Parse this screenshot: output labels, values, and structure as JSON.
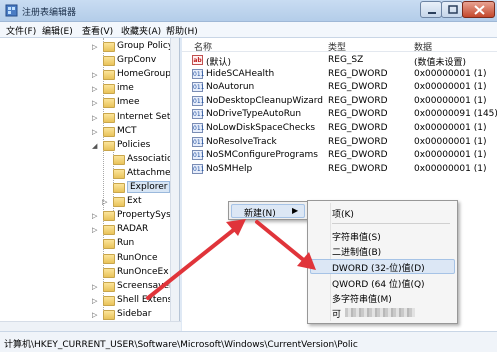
{
  "window": {
    "title": "注册表编辑器"
  },
  "menubar": [
    "文件(F)",
    "编辑(E)",
    "查看(V)",
    "收藏夹(A)",
    "帮助(H)"
  ],
  "tree": {
    "items": [
      {
        "label": "Group Policy",
        "expander": "▷"
      },
      {
        "label": "GrpConv",
        "expander": ""
      },
      {
        "label": "HomeGroup",
        "expander": "▷"
      },
      {
        "label": "ime",
        "expander": "▷"
      },
      {
        "label": "Imee",
        "expander": "▷"
      },
      {
        "label": "Internet Setti",
        "expander": "▷"
      },
      {
        "label": "MCT",
        "expander": "▷"
      },
      {
        "label": "Policies",
        "expander": "◢"
      },
      {
        "label": "Associatic",
        "expander": ""
      },
      {
        "label": "Attachmer",
        "expander": ""
      },
      {
        "label": "Explorer",
        "expander": "",
        "selected": true
      },
      {
        "label": "Ext",
        "expander": "▷"
      },
      {
        "label": "PropertySyste",
        "expander": "▷"
      },
      {
        "label": "RADAR",
        "expander": "▷"
      },
      {
        "label": "Run",
        "expander": ""
      },
      {
        "label": "RunOnce",
        "expander": ""
      },
      {
        "label": "RunOnceEx",
        "expander": ""
      },
      {
        "label": "Screensavers",
        "expander": "▷"
      },
      {
        "label": "Shell Extensic",
        "expander": "▷"
      },
      {
        "label": "Sidebar",
        "expander": "▷"
      }
    ]
  },
  "list": {
    "headers": {
      "name": "名称",
      "type": "类型",
      "data": "数据"
    },
    "rows": [
      {
        "icon": "ab",
        "kind": "sz",
        "name": "(默认)",
        "type": "REG_SZ",
        "data": "(数值未设置)"
      },
      {
        "icon": "011",
        "kind": "dw",
        "name": "HideSCAHealth",
        "type": "REG_DWORD",
        "data": "0x00000001 (1)"
      },
      {
        "icon": "011",
        "kind": "dw",
        "name": "NoAutorun",
        "type": "REG_DWORD",
        "data": "0x00000001 (1)"
      },
      {
        "icon": "011",
        "kind": "dw",
        "name": "NoDesktopCleanupWizard",
        "type": "REG_DWORD",
        "data": "0x00000001 (1)"
      },
      {
        "icon": "011",
        "kind": "dw",
        "name": "NoDriveTypeAutoRun",
        "type": "REG_DWORD",
        "data": "0x00000091 (145)"
      },
      {
        "icon": "011",
        "kind": "dw",
        "name": "NoLowDiskSpaceChecks",
        "type": "REG_DWORD",
        "data": "0x00000001 (1)"
      },
      {
        "icon": "011",
        "kind": "dw",
        "name": "NoResolveTrack",
        "type": "REG_DWORD",
        "data": "0x00000001 (1)"
      },
      {
        "icon": "011",
        "kind": "dw",
        "name": "NoSMConfigurePrograms",
        "type": "REG_DWORD",
        "data": "0x00000001 (1)"
      },
      {
        "icon": "011",
        "kind": "dw",
        "name": "NoSMHelp",
        "type": "REG_DWORD",
        "data": "0x00000001 (1)"
      }
    ]
  },
  "context_menu": {
    "new_label": "新建(N)",
    "arrow": "▶"
  },
  "submenu": {
    "items": [
      {
        "label": "项(K)"
      },
      {
        "label": "字符串值(S)"
      },
      {
        "label": "二进制值(B)"
      },
      {
        "label": "DWORD (32-位)值(D)",
        "highlighted": true
      },
      {
        "label": "QWORD (64 位)值(Q)"
      },
      {
        "label": "多字符串值(M)"
      },
      {
        "label": "可"
      }
    ]
  },
  "statusbar": {
    "path": "计算机\\HKEY_CURRENT_USER\\Software\\Microsoft\\Windows\\CurrentVersion\\Polic"
  },
  "colors": {
    "annotation_arrow": "#e0343a"
  }
}
